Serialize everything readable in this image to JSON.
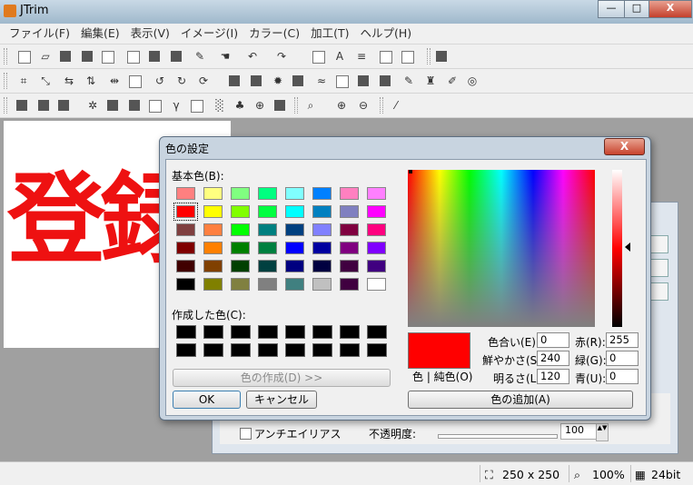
{
  "app": {
    "title": "JTrim",
    "window_buttons": [
      "—",
      "□",
      "X"
    ]
  },
  "menu": [
    "ファイル(F)",
    "編集(E)",
    "表示(V)",
    "イメージ(I)",
    "カラー(C)",
    "加工(T)",
    "ヘルプ(H)"
  ],
  "canvas": {
    "text": "登録"
  },
  "bg_dialog": {
    "antialias_label": "アンチエイリアス",
    "opacity_label": "不透明度:",
    "opacity_value": "100"
  },
  "color_dialog": {
    "title": "色の設定",
    "close_label": "X",
    "basic_colors_label": "基本色(B):",
    "custom_colors_label": "作成した色(C):",
    "define_custom_label": "色の作成(D) >>",
    "ok_label": "OK",
    "cancel_label": "キャンセル",
    "color_solid_label": "色 | 純色(O)",
    "hue_label": "色合い(E):",
    "hue_value": "0",
    "sat_label": "鮮やかさ(S):",
    "sat_value": "240",
    "lum_label": "明るさ(L):",
    "lum_value": "120",
    "red_label": "赤(R):",
    "red_value": "255",
    "green_label": "緑(G):",
    "green_value": "0",
    "blue_label": "青(U):",
    "blue_value": "0",
    "add_custom_label": "色の追加(A)",
    "basic_colors": [
      "#ff8080",
      "#ffff80",
      "#80ff80",
      "#00ff80",
      "#80ffff",
      "#0080ff",
      "#ff80c0",
      "#ff80ff",
      "#ff0000",
      "#ffff00",
      "#80ff00",
      "#00ff40",
      "#00ffff",
      "#0080c0",
      "#8080c0",
      "#ff00ff",
      "#804040",
      "#ff8040",
      "#00ff00",
      "#008080",
      "#004080",
      "#8080ff",
      "#800040",
      "#ff0080",
      "#800000",
      "#ff8000",
      "#008000",
      "#008040",
      "#0000ff",
      "#0000a0",
      "#800080",
      "#8000ff",
      "#400000",
      "#804000",
      "#004000",
      "#004040",
      "#000080",
      "#000040",
      "#400040",
      "#400080",
      "#000000",
      "#808000",
      "#808040",
      "#808080",
      "#408080",
      "#c0c0c0",
      "#400040",
      "#ffffff"
    ],
    "selected_index": 8,
    "current_color": "#ff0000"
  },
  "status": {
    "size": "250 x 250",
    "zoom": "100%",
    "bits": "24bit"
  }
}
